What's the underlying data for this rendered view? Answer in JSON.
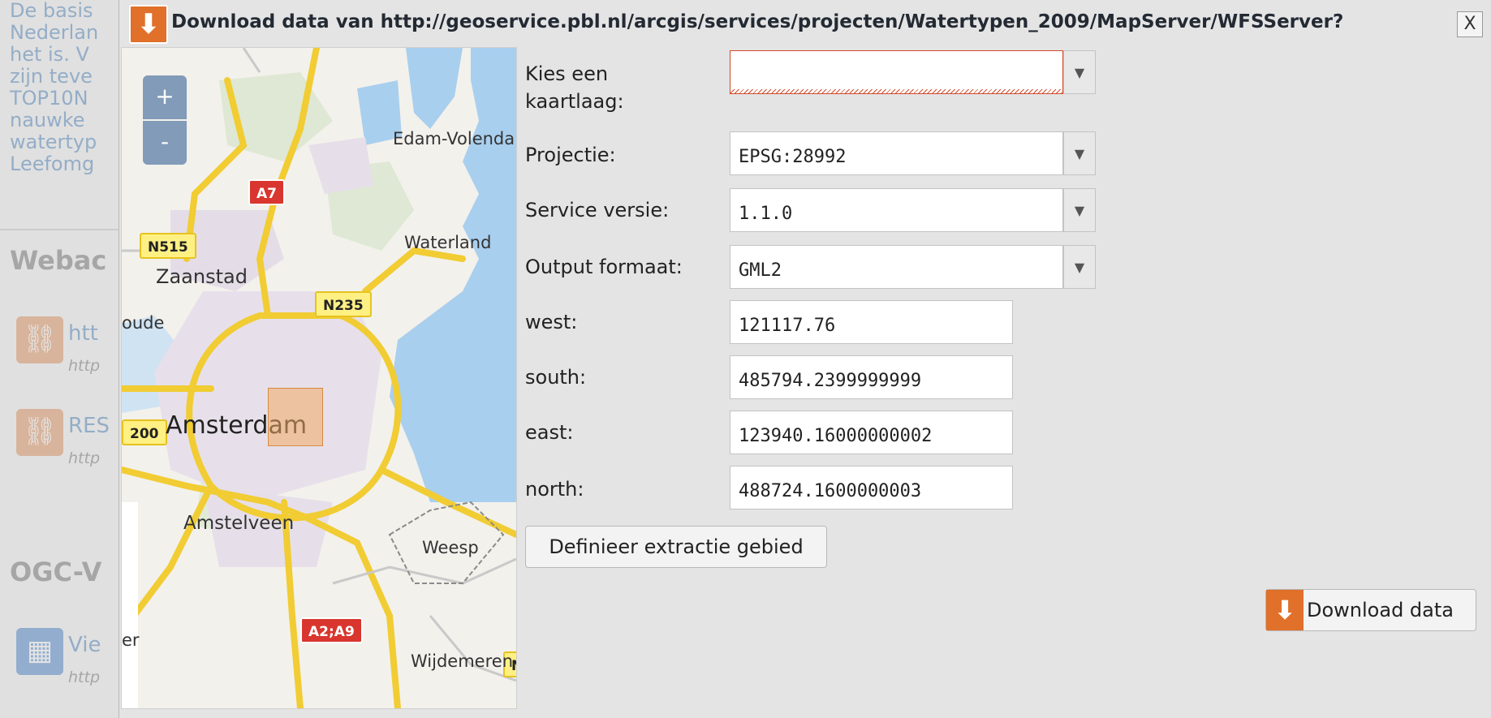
{
  "background": {
    "lines": [
      "De basis",
      "Nederlan",
      "het is. V",
      "zijn teve",
      "TOP10N",
      "nauwke",
      "watertyp",
      "Leefomg"
    ],
    "heading_web": "Webac",
    "heading_ogc": "OGC-V",
    "links": [
      {
        "title": "htt",
        "url": "http"
      },
      {
        "title": "RES",
        "url": "http"
      },
      {
        "title": "Vie",
        "url": "http"
      }
    ]
  },
  "dialog": {
    "title": "Download data van http://geoservice.pbl.nl/arcgis/services/projecten/Watertypen_2009/MapServer/WFSServer?",
    "close_label": "X"
  },
  "map": {
    "zoom_in": "+",
    "zoom_out": "-",
    "shields": [
      "A7",
      "N515",
      "N235",
      "200",
      "A2;A9",
      "N"
    ],
    "labels": [
      "Edam-Volendam",
      "Waterland",
      "Zaanstad",
      "oude",
      "Amsterdam",
      "Amstelveen",
      "Weesp",
      "Wijdemeren",
      "er"
    ]
  },
  "form": {
    "layer_label": "Kies een kaartlaag:",
    "layer_value": "",
    "projection_label": "Projectie:",
    "projection_value": "EPSG:28992",
    "version_label": "Service versie:",
    "version_value": "1.1.0",
    "format_label": "Output formaat:",
    "format_value": "GML2",
    "west_label": "west:",
    "west_value": "121117.76",
    "south_label": "south:",
    "south_value": "485794.2399999999",
    "east_label": "east:",
    "east_value": "123940.16000000002",
    "north_label": "north:",
    "north_value": "488724.1600000003",
    "define_button": "Definieer extractie gebied",
    "download_button": "Download data"
  },
  "colors": {
    "accent": "#e0702a",
    "invalid_border": "#d04a2a",
    "road_red": "#d8362e",
    "road_yellow": "#fff084",
    "water": "#a9cfee"
  }
}
